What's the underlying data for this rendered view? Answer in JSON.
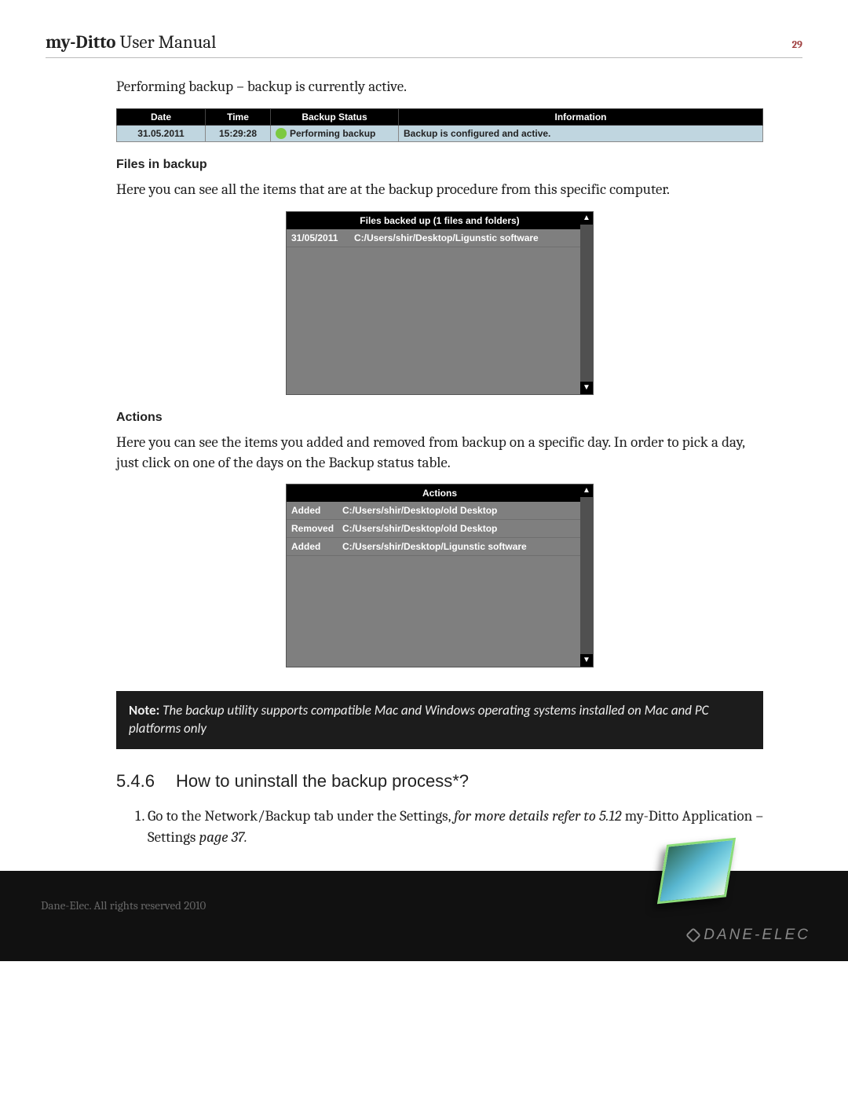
{
  "header": {
    "title_bold": "my-Ditto",
    "title_rest": " User Manual",
    "page_number": "29"
  },
  "intro_text": "Performing backup – backup is currently active.",
  "status_table": {
    "headers": [
      "Date",
      "Time",
      "Backup Status",
      "Information"
    ],
    "row": {
      "date": "31.05.2011",
      "time": "15:29:28",
      "status": "Performing backup",
      "info": "Backup is configured and active."
    }
  },
  "files_section": {
    "heading": "Files in backup",
    "description": "Here you can see all the items that are at the backup procedure from this specific computer.",
    "panel_title": "Files backed up (1 files and folders)",
    "rows": [
      {
        "date": "31/05/2011",
        "path": "C:/Users/shir/Desktop/Ligunstic software"
      }
    ]
  },
  "actions_section": {
    "heading": "Actions",
    "description": "Here you can see the items you added and removed from backup on a specific day. In order to pick a day, just click on one of the days on the Backup status table.",
    "panel_title": "Actions",
    "rows": [
      {
        "action": "Added",
        "path": "C:/Users/shir/Desktop/old Desktop"
      },
      {
        "action": "Removed",
        "path": "C:/Users/shir/Desktop/old Desktop"
      },
      {
        "action": "Added",
        "path": "C:/Users/shir/Desktop/Ligunstic software"
      }
    ]
  },
  "note": {
    "label": "Note:",
    "text": " The backup utility supports compatible Mac and Windows operating systems installed on Mac and PC platforms only"
  },
  "section_546": {
    "number": "5.4.6",
    "title": "How to uninstall the backup process*?",
    "step1_a": "Go to the Network/Backup tab under the Settings, ",
    "step1_b": "for more details refer to 5.12 ",
    "step1_c": "my-Ditto Application – Settings ",
    "step1_d": "page 37.",
    "step_num": "1."
  },
  "footer": {
    "copyright": "Dane-Elec. All rights reserved 2010",
    "brand": "DANE-ELEC"
  }
}
